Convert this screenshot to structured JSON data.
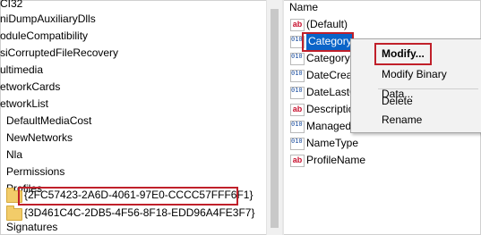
{
  "tree": {
    "items": [
      {
        "label": "CI32"
      },
      {
        "label": "niDumpAuxiliaryDlls"
      },
      {
        "label": "oduleCompatibility"
      },
      {
        "label": "siCorruptedFileRecovery"
      },
      {
        "label": "ultimedia"
      },
      {
        "label": "etworkCards"
      },
      {
        "label": "etworkList"
      },
      {
        "label": "DefaultMediaCost"
      },
      {
        "label": "NewNetworks"
      },
      {
        "label": "Nla"
      },
      {
        "label": "Permissions"
      },
      {
        "label": "Profiles"
      },
      {
        "label": "{2FC57423-2A6D-4061-97E0-CCCC57FFF6F1}"
      },
      {
        "label": "{3D461C4C-2DB5-4F56-8F18-EDD96A4FE3F7}"
      },
      {
        "label": "Signatures"
      }
    ]
  },
  "values": {
    "column_header": "Name",
    "rows": [
      {
        "icon": "ab",
        "label": "(Default)"
      },
      {
        "icon": "bin",
        "label": "Category"
      },
      {
        "icon": "bin",
        "label": "CategoryT"
      },
      {
        "icon": "bin",
        "label": "DateCreat"
      },
      {
        "icon": "bin",
        "label": "DateLastC"
      },
      {
        "icon": "ab",
        "label": "Descriptio"
      },
      {
        "icon": "bin",
        "label": "Managed"
      },
      {
        "icon": "bin",
        "label": "NameType"
      },
      {
        "icon": "ab",
        "label": "ProfileName"
      }
    ]
  },
  "icons": {
    "string_value": "ab",
    "binary_value": "010\n110"
  },
  "context_menu": {
    "modify": "Modify...",
    "modify_binary": "Modify Binary Data...",
    "delete": "Delete",
    "rename": "Rename"
  },
  "colors": {
    "highlight_border": "#c0202a",
    "selection": "#0a64c8"
  }
}
